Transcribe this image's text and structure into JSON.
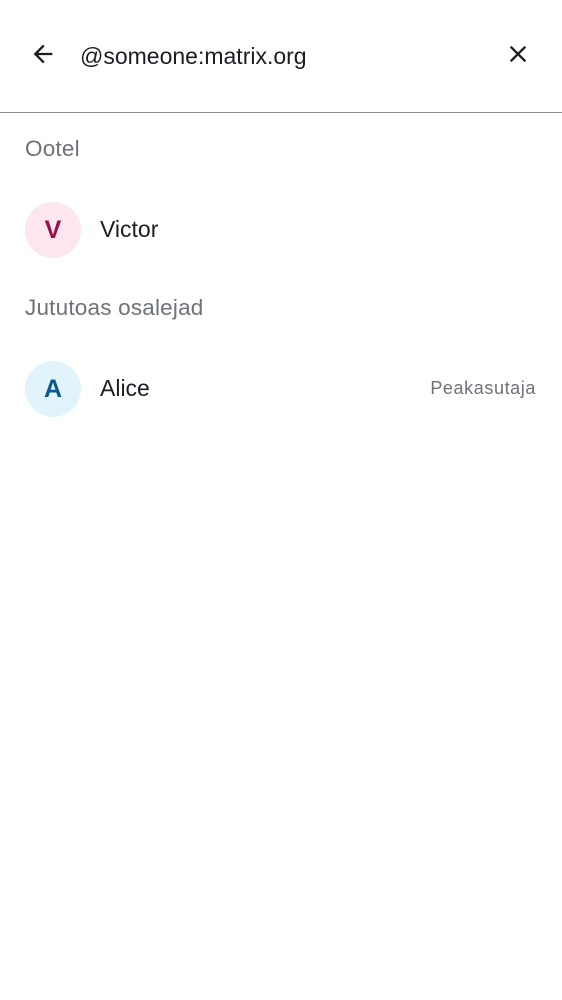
{
  "search": {
    "query": "@someone:matrix.org",
    "back_icon": "arrow-left-icon",
    "clear_icon": "close-icon"
  },
  "sections": [
    {
      "title": "Ootel",
      "members": [
        {
          "initial": "V",
          "name": "Victor",
          "role": ""
        }
      ]
    },
    {
      "title": "Jututoas osalejad",
      "members": [
        {
          "initial": "A",
          "name": "Alice",
          "role": "Peakasutaja"
        }
      ]
    }
  ],
  "colors": {
    "victor_avatar_bg": "#fde6ee",
    "victor_avatar_fg": "#99114b",
    "alice_avatar_bg": "#e1f4fb",
    "alice_avatar_fg": "#0b5a8a",
    "secondary_text": "#6e7178",
    "primary_text": "#1b1d22"
  }
}
